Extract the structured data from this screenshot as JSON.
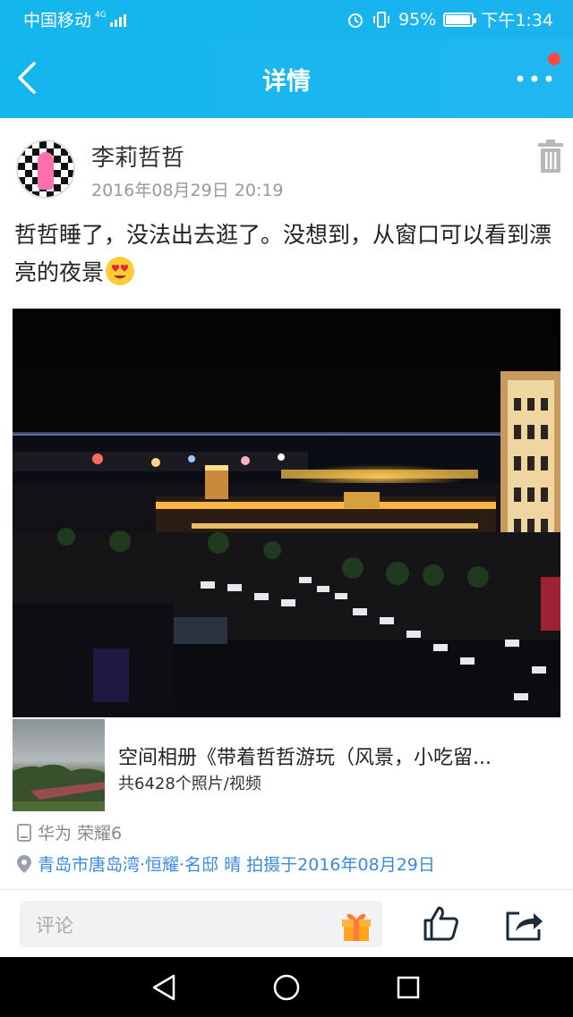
{
  "status_bar": {
    "carrier": "中国移动",
    "network": "4G",
    "battery_percent": "95%",
    "battery_level": 0.95,
    "time": "下午1:34"
  },
  "titlebar": {
    "title": "详情",
    "back_icon": "chevron-left-icon",
    "more_icon": "more-dots-icon"
  },
  "post": {
    "author": "李莉哲哲",
    "timestamp": "2016年08月29日 20:19",
    "text": "哲哲睡了，没法出去逛了。没想到，从窗口可以看到漂亮的夜景",
    "emoji_icon": "heart-eyes-emoji-icon",
    "delete_icon": "trash-icon"
  },
  "album": {
    "title": "空间相册《带着哲哲游玩（风景，小吃留...",
    "count": "共6428个照片/视频"
  },
  "meta": {
    "device_icon": "phone-icon",
    "device": "华为 荣耀6",
    "location_icon": "location-pin-icon",
    "location": "青岛市唐岛湾·恒耀·名邸 晴 拍摄于2016年08月29日"
  },
  "bottom_bar": {
    "comment_placeholder": "评论",
    "gift_icon": "gift-icon",
    "like_icon": "thumbs-up-icon",
    "share_icon": "share-icon"
  },
  "nav_bar": {
    "back_icon": "triangle-back-icon",
    "home_icon": "circle-home-icon",
    "recent_icon": "square-recent-icon"
  },
  "colors": {
    "accent": "#1ab3ef",
    "notification_dot": "#ff4a3d",
    "location_text": "#3a8be0"
  }
}
